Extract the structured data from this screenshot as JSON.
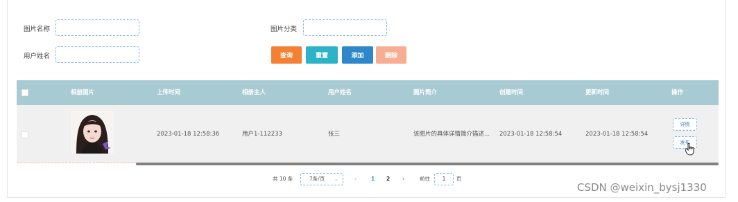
{
  "filters": {
    "image_name_label": "图片名称",
    "image_name_value": "",
    "image_category_label": "图片分类",
    "image_category_value": "",
    "user_name_label": "用户姓名",
    "user_name_value": ""
  },
  "actions": {
    "search": "查询",
    "reset": "重置",
    "add": "添加",
    "delete": "删除"
  },
  "colors": {
    "search": "#f38133",
    "reset": "#2cb3c6",
    "add": "#2e87c9",
    "delete": "#f6ad92",
    "table_header": "#a8cbd3"
  },
  "table": {
    "columns": [
      "相册图片",
      "上传时间",
      "相册主人",
      "用户姓名",
      "图片简介",
      "创建时间",
      "更新时间",
      "操作"
    ],
    "rows": [
      {
        "upload_time": "2023-01-18 12:58:36",
        "album_owner": "用户1-112233",
        "user_name": "张三",
        "intro": "该图片的具体详情简介描述...",
        "created_at": "2023-01-18 12:58:54",
        "updated_at": "2023-01-18 12:58:54",
        "detail_label": "详情",
        "publish_label": "发布"
      }
    ]
  },
  "pagination": {
    "total": "共 10 条",
    "page_size": "7条/页",
    "prev": "‹",
    "pages": [
      "1",
      "2"
    ],
    "current": "1",
    "next": "›",
    "goto_label": "前往",
    "goto_value": "1",
    "page_suffix": "页"
  },
  "watermark": "CSDN @weixin_bysj1330"
}
